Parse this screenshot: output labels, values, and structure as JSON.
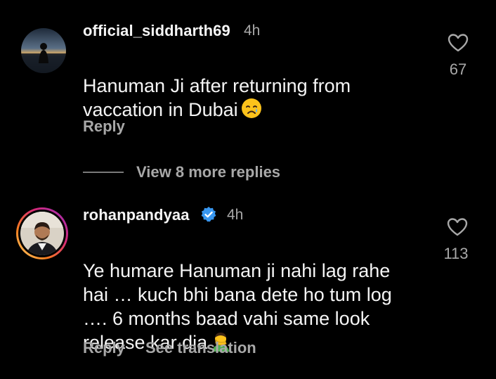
{
  "comments": [
    {
      "username": "official_siddharth69",
      "time": "4h",
      "text": "Hanuman Ji after returning from\nvaccation in Dubai",
      "emoji": "crying-face-emoji",
      "likes": "67",
      "reply_label": "Reply"
    },
    {
      "username": "rohanpandyaa",
      "verified": true,
      "time": "4h",
      "text": "Ye humare Hanuman ji nahi lag rahe\nhai … kuch bhi bana dete ho tum log\n…. 6 months baad vahi same look\nrelease kar dia",
      "emoji": "man-facepalming-emoji",
      "likes": "113",
      "reply_label": "Reply",
      "translate_label": "See translation"
    }
  ],
  "view_replies_label": "View 8 more replies",
  "colors": {
    "background": "#000000",
    "primary_text": "#f5f5f5",
    "secondary_text": "#a8a8a8",
    "verified_blue": "#3897f0",
    "story_ring": [
      "#feda75",
      "#fa7e1e",
      "#d62976",
      "#962fbf"
    ]
  }
}
